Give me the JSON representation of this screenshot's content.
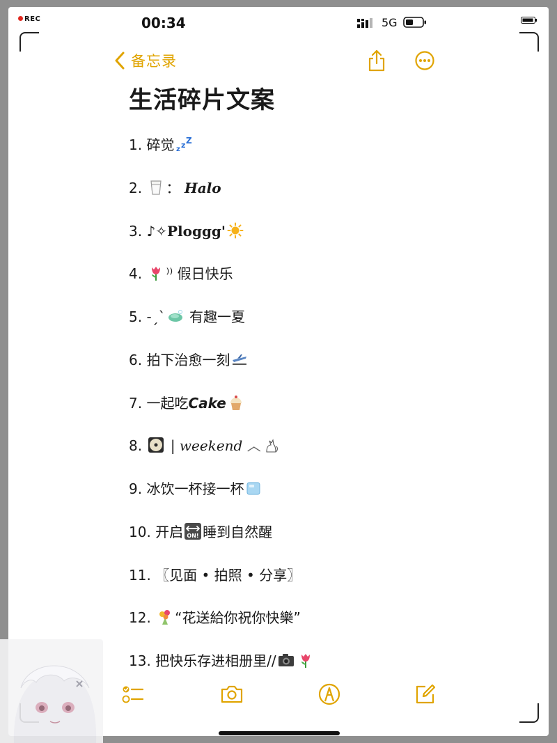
{
  "status_bar": {
    "rec": "REC",
    "time": "00:34",
    "network": "5G"
  },
  "nav": {
    "back_label": "备忘录"
  },
  "note": {
    "title": "生活碎片文案",
    "items": [
      {
        "n": "1.",
        "a": "碎觉",
        "b": "",
        "c": ""
      },
      {
        "n": "2.",
        "a": "：",
        "b": "Halo",
        "c": ""
      },
      {
        "n": "3.",
        "a": "♪✧",
        "b": "Ploggg'",
        "c": ""
      },
      {
        "n": "4.",
        "a": "⁾⁾ 假日快乐",
        "b": "",
        "c": ""
      },
      {
        "n": "5.",
        "a": "-ˏˋ",
        "b": "有趣一夏",
        "c": ""
      },
      {
        "n": "6.",
        "a": "拍下治愈一刻",
        "b": "",
        "c": ""
      },
      {
        "n": "7.",
        "a": "一起吃",
        "b": "Cake",
        "c": ""
      },
      {
        "n": "8.",
        "a": "|",
        "b": "weekend",
        "c": "︿"
      },
      {
        "n": "9.",
        "a": "冰饮一杯接一杯",
        "b": "",
        "c": ""
      },
      {
        "n": "10.",
        "a": "开启",
        "b": "睡到自然醒",
        "c": ""
      },
      {
        "n": "11.",
        "a": "〖见面 • 拍照 • 分享〗",
        "b": "",
        "c": ""
      },
      {
        "n": "12.",
        "a": "“花送給你祝你快樂”",
        "b": "",
        "c": ""
      },
      {
        "n": "13.",
        "a": "把快乐存进相册里",
        "b": "//",
        "c": ""
      }
    ]
  },
  "icons": {
    "back": "chevron-left-icon",
    "share": "share-icon",
    "more": "ellipsis-circle-icon",
    "checklist": "checklist-icon",
    "camera": "camera-icon",
    "markup": "markup-pen-icon",
    "compose": "compose-icon"
  },
  "colors": {
    "accent": "#e0a400",
    "text": "#1a1a1a",
    "background": "#ffffff"
  }
}
